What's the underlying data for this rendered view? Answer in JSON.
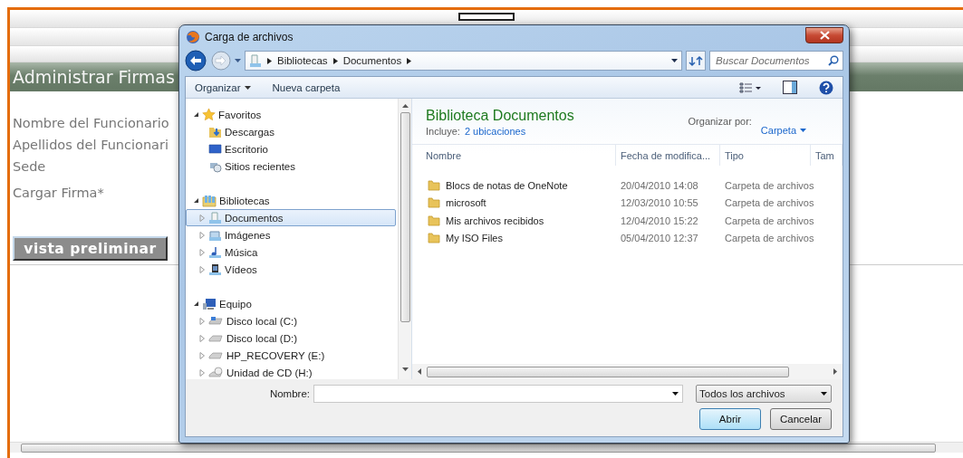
{
  "page": {
    "header": "Administrar Firmas",
    "labels": [
      "Nombre del Funcionario",
      "Apellidos del Funcionari",
      "Sede",
      "Cargar Firma*"
    ],
    "button": "vista preliminar"
  },
  "dialog": {
    "title": "Carga de archivos",
    "breadcrumb": [
      "Bibliotecas",
      "Documentos"
    ],
    "search": {
      "placeholder": "Buscar Documentos"
    },
    "toolbar": [
      "Organizar",
      "Nueva carpeta"
    ],
    "tree": [
      {
        "label": "Favoritos",
        "expanded": true,
        "children": [
          {
            "label": "Descargas",
            "expander": false,
            "selected": false
          },
          {
            "label": "Escritorio",
            "expander": false,
            "selected": false
          },
          {
            "label": "Sitios recientes",
            "expander": false,
            "selected": false
          }
        ]
      },
      {
        "label": "Bibliotecas",
        "expanded": true,
        "children": [
          {
            "label": "Documentos",
            "expander": true,
            "selected": true
          },
          {
            "label": "Imágenes",
            "expander": true,
            "selected": false
          },
          {
            "label": "Música",
            "expander": true,
            "selected": false
          },
          {
            "label": "Vídeos",
            "expander": true,
            "selected": false
          }
        ]
      },
      {
        "label": "Equipo",
        "expanded": true,
        "children": [
          {
            "label": "Disco local (C:)",
            "expander": true,
            "selected": false
          },
          {
            "label": "Disco local (D:)",
            "expander": true,
            "selected": false
          },
          {
            "label": "HP_RECOVERY (E:)",
            "expander": true,
            "selected": false
          },
          {
            "label": "Unidad de CD (H:)",
            "expander": true,
            "selected": false
          }
        ]
      }
    ],
    "library": {
      "title": "Biblioteca Documentos",
      "includes_label": "Incluye:",
      "includes_link": "2 ubicaciones",
      "arrange_label": "Organizar por:",
      "arrange_value": "Carpeta"
    },
    "columns": [
      "Nombre",
      "Fecha de modifica...",
      "Tipo",
      "Tam"
    ],
    "rows": [
      {
        "name": "Blocs de notas de OneNote",
        "date": "20/04/2010 14:08",
        "type": "Carpeta de archivos"
      },
      {
        "name": "microsoft",
        "date": "12/03/2010 10:55",
        "type": "Carpeta de archivos"
      },
      {
        "name": "Mis archivos recibidos",
        "date": "12/04/2010 15:22",
        "type": "Carpeta de archivos"
      },
      {
        "name": "My ISO Files",
        "date": "05/04/2010 12:37",
        "type": "Carpeta de archivos"
      }
    ],
    "filename_label": "Nombre:",
    "filter": "Todos los archivos",
    "buttons": [
      "Abrir",
      "Cancelar"
    ]
  }
}
